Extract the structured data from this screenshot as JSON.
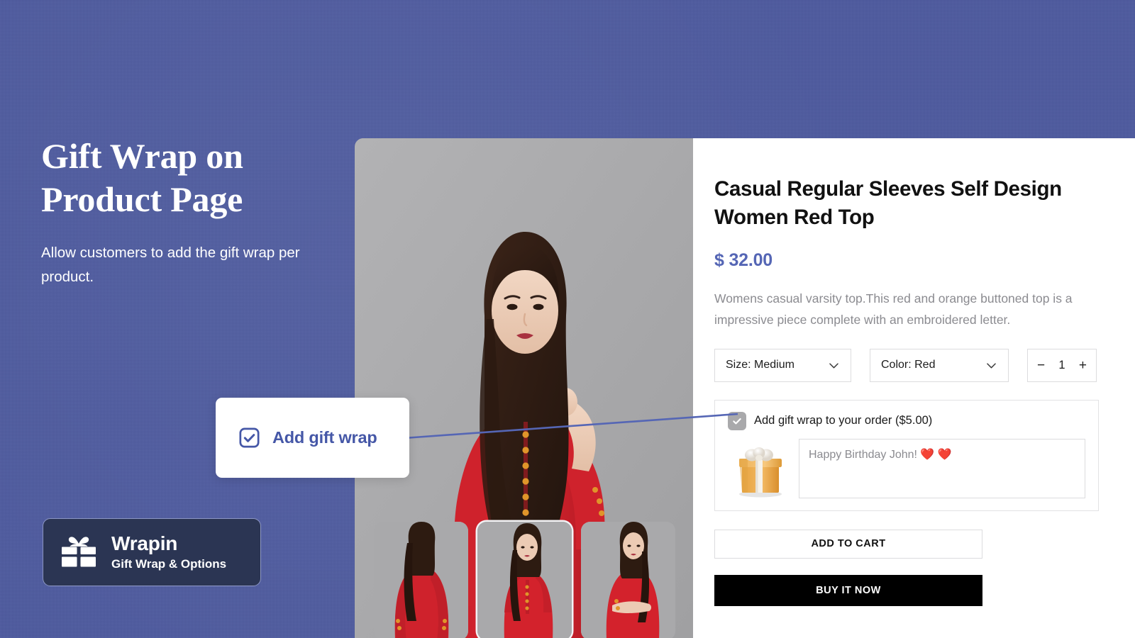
{
  "theme": {
    "background": "#4c59a0",
    "accent": "#4557a7",
    "price_color": "#5566b5",
    "badge_bg": "#2b3553",
    "buy_button_bg": "#000000",
    "image_panel_bg": "#a9a9ab"
  },
  "promo": {
    "headline_line1": "Gift Wrap on",
    "headline_line2": "Product Page",
    "subhead": "Allow customers to add the gift wrap per product."
  },
  "callout": {
    "label": "Add gift wrap",
    "icon": "checkbox-checked-icon"
  },
  "badge": {
    "icon": "gift-icon",
    "title": "Wrapin",
    "subtitle": "Gift Wrap & Options"
  },
  "product": {
    "title": "Casual Regular Sleeves Self Design Women Red Top",
    "price": "$ 32.00",
    "description": "Womens casual varsity top.This red and orange buttoned top is a impressive piece complete with an embroidered letter.",
    "thumbnails": [
      {
        "alt": "back view",
        "selected": false
      },
      {
        "alt": "front view",
        "selected": true
      },
      {
        "alt": "side view",
        "selected": false
      }
    ],
    "options": [
      {
        "name": "size",
        "label": "Size: Medium",
        "icon": "chevron-down-icon"
      },
      {
        "name": "color",
        "label": "Color: Red",
        "icon": "chevron-down-icon"
      }
    ],
    "quantity": {
      "decrease": "−",
      "value": "1",
      "increase": "+"
    },
    "gift_wrap": {
      "checkbox_label": "Add gift wrap to your order ($5.00)",
      "checked": true,
      "gift_icon": "gift-box-icon",
      "message_value": "Happy Birthday John! ❤️ ❤️",
      "message_placeholder": "Happy Birthday John! ❤️ ❤️"
    },
    "actions": {
      "add_to_cart": "ADD TO CART",
      "buy_it_now": "BUY IT NOW"
    }
  }
}
